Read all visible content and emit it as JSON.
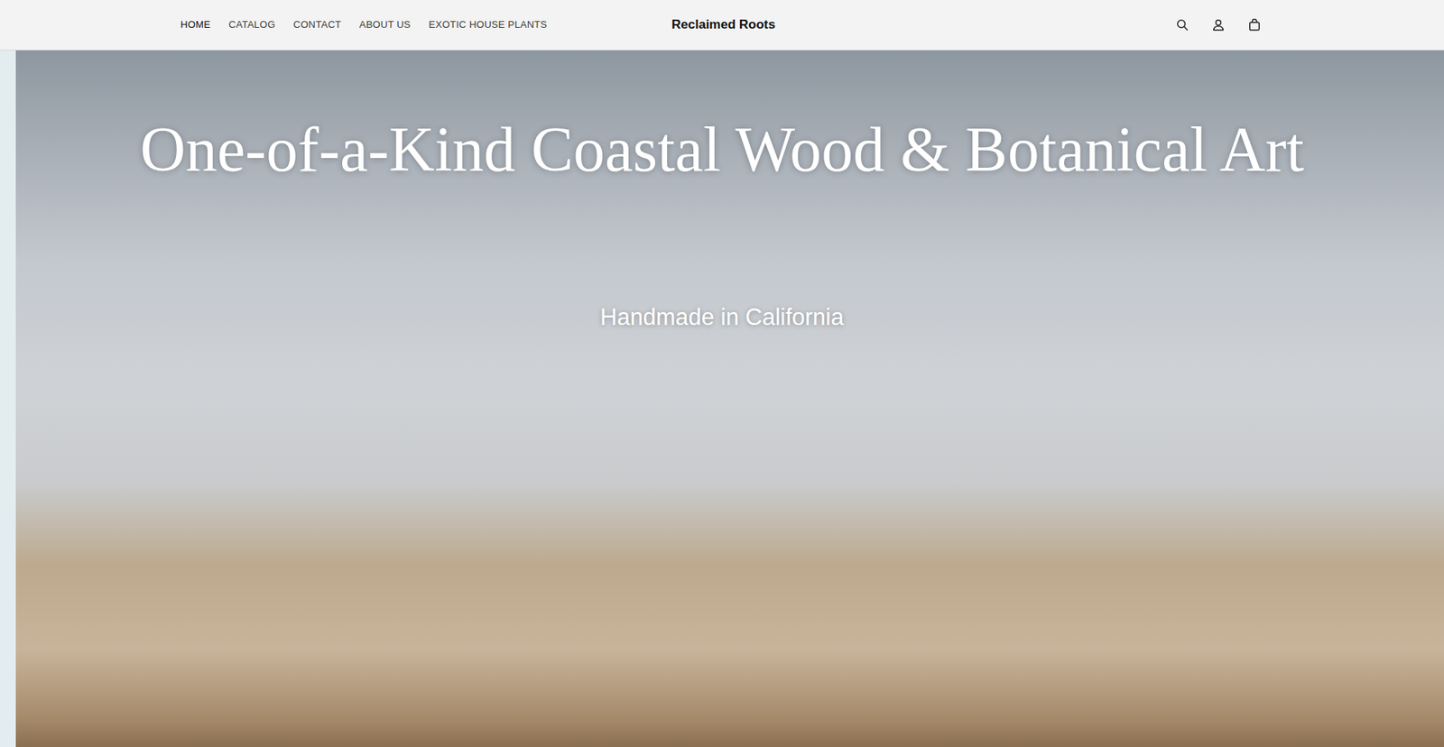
{
  "header": {
    "nav": [
      {
        "label": "HOME",
        "selected": true
      },
      {
        "label": "CATALOG",
        "selected": false
      },
      {
        "label": "CONTACT",
        "selected": false
      },
      {
        "label": "ABOUT US",
        "selected": false
      },
      {
        "label": "EXOTIC HOUSE PLANTS",
        "selected": false
      }
    ],
    "logo": "Reclaimed Roots"
  },
  "hero": {
    "title": "One-of-a-Kind Coastal Wood & Botanical Art",
    "subtitle": "Handmade in California"
  }
}
